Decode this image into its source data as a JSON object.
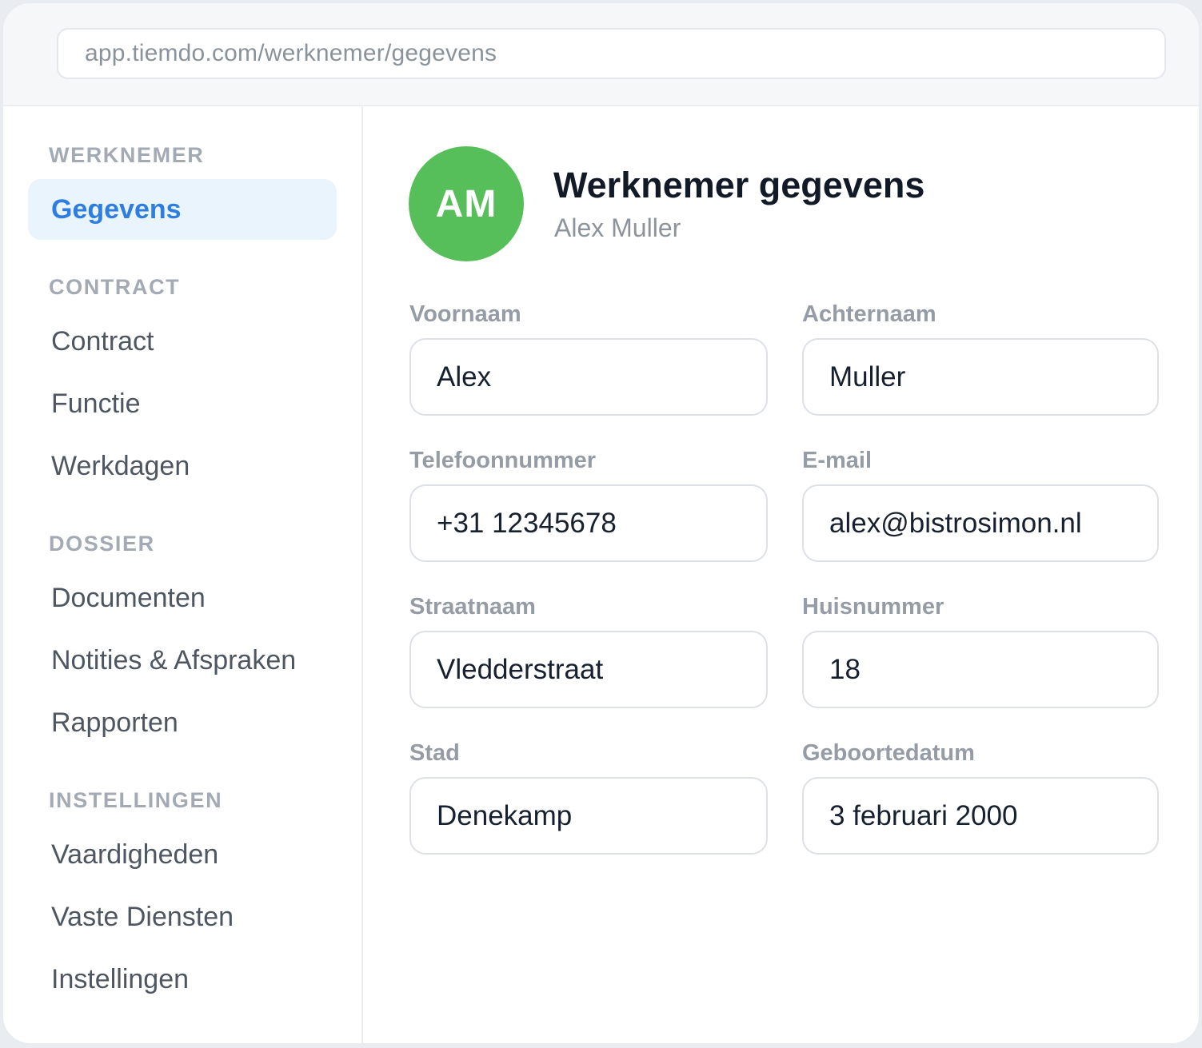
{
  "url": "app.tiemdo.com/werknemer/gegevens",
  "sidebar": {
    "sections": [
      {
        "title": "WERKNEMER",
        "items": [
          {
            "label": "Gegevens",
            "active": true
          }
        ]
      },
      {
        "title": "CONTRACT",
        "items": [
          {
            "label": "Contract"
          },
          {
            "label": "Functie"
          },
          {
            "label": "Werkdagen"
          }
        ]
      },
      {
        "title": "DOSSIER",
        "items": [
          {
            "label": "Documenten"
          },
          {
            "label": "Notities & Afspraken"
          },
          {
            "label": "Rapporten"
          }
        ]
      },
      {
        "title": "INSTELLINGEN",
        "items": [
          {
            "label": "Vaardigheden"
          },
          {
            "label": "Vaste Diensten"
          },
          {
            "label": "Instellingen"
          }
        ]
      }
    ]
  },
  "header": {
    "avatar_initials": "AM",
    "avatar_color": "#57bf59",
    "title": "Werknemer gegevens",
    "subtitle": "Alex Muller"
  },
  "form": {
    "first_name": {
      "label": "Voornaam",
      "value": "Alex"
    },
    "last_name": {
      "label": "Achternaam",
      "value": "Muller"
    },
    "phone": {
      "label": "Telefoonnummer",
      "value": "+31 12345678"
    },
    "email": {
      "label": "E-mail",
      "value": "alex@bistrosimon.nl"
    },
    "street": {
      "label": "Straatnaam",
      "value": "Vledderstraat"
    },
    "house_number": {
      "label": "Huisnummer",
      "value": "18"
    },
    "city": {
      "label": "Stad",
      "value": "Denekamp"
    },
    "birth_date": {
      "label": "Geboortedatum",
      "value": "3 februari 2000"
    }
  },
  "colors": {
    "accent": "#2e7de0",
    "active_bg": "#eaf4fd"
  }
}
